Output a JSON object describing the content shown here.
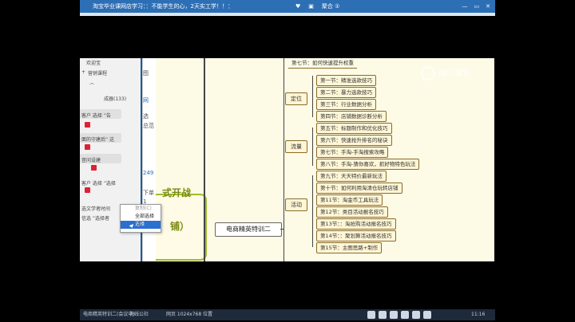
{
  "titlebar": {
    "title": "淘宝毕业课网店学习：：不能学生的心，2天实工学！！：",
    "status": "聚合 ①",
    "win_buttons": [
      "—",
      "▭",
      "✕"
    ]
  },
  "left_panel": {
    "items": [
      "欢迎宝",
      "营销课程",
      "成器(133)",
      "客户 选择 ”告",
      "面的守建后” 这",
      "音问设建",
      "客户 选择 ”选择",
      "选择者",
      "选文学者时间",
      "信选 ”选择者"
    ],
    "tree_toggle": "+",
    "collapse": "︿"
  },
  "mid_strip": {
    "a": "图",
    "b": "网",
    "c": "选",
    "d": "总范",
    "e": "249",
    "f": "下单",
    "g": "1"
  },
  "mindmap": {
    "root": "电商精英特训二",
    "side_title_1": "式开战",
    "side_title_2": "铺）",
    "top_node": "第七节：如何快速提升权重",
    "categories": [
      {
        "label": "定位",
        "nodes": [
          "第一节：精准选款技巧",
          "第二节：暴力选款技巧",
          "第三节：行业数据分析",
          "第四节：店铺数据诊断分析"
        ]
      },
      {
        "label": "流量",
        "nodes": [
          "第五节：标题制作和优化技巧",
          "第六节：快速抢升排名的秘诀",
          "第七节：手淘-手淘搜索攻略",
          "第八节：手淘-猜你喜欢，抓好物特色玩法"
        ]
      },
      {
        "label": "活动",
        "nodes": [
          "第九节：天天特价最新玩法",
          "第十节：如何利用淘清仓玩转店铺",
          "第11节：淘金币工具玩法",
          "第12节：类目活动报名技巧",
          "第13节：：淘抢购活动报名技巧",
          "第14节：：聚划算活动报名技巧",
          "第15节：主图思路+制作"
        ]
      }
    ],
    "watermark": "维尔课堂"
  },
  "context_menu": {
    "items": [
      "复制(C)",
      "全部选择(A)",
      "选择"
    ]
  },
  "taskbar": {
    "items": [
      "电商精英特训二(会议中)",
      "无线公社",
      "网页 1024x768 位置"
    ],
    "time": "11:16"
  },
  "colors": {
    "accent": "#2d6fb5",
    "node_border": "#8b6a2a",
    "green": "#9bbd2f"
  }
}
